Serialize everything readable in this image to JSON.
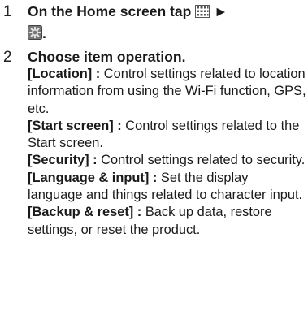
{
  "steps": [
    {
      "number": "1",
      "title_prefix": "On the Home screen tap",
      "arrow": "►",
      "title_suffix": ".",
      "icons": [
        "app-grid-icon",
        "settings-icon"
      ]
    },
    {
      "number": "2",
      "title": "Choose item operation.",
      "items": [
        {
          "term": "[Location] :",
          "text": " Control settings related to location information from using the Wi-Fi function, GPS, etc."
        },
        {
          "term": "[Start screen] :",
          "text": " Control settings related to the Start screen."
        },
        {
          "term": "[Security] :",
          "text": " Control settings related to security."
        },
        {
          "term": "[Language & input] :",
          "text": " Set the display language and things related to character input."
        },
        {
          "term": "[Backup & reset] :",
          "text": " Back up data, restore settings, or reset the product."
        }
      ]
    }
  ]
}
